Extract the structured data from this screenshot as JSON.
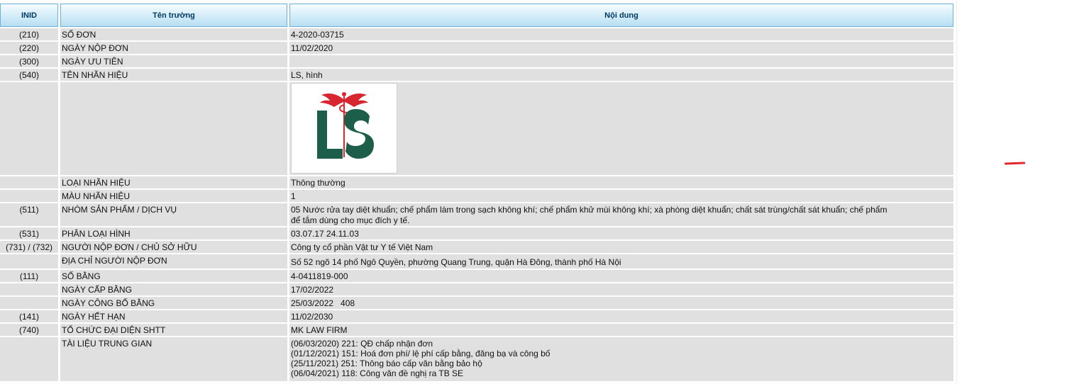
{
  "header": {
    "inid": "INID",
    "field": "Tên trường",
    "content": "Nội dung"
  },
  "rows": {
    "so_don": {
      "inid": "(210)",
      "field": "SỐ ĐƠN",
      "value": "4-2020-03715"
    },
    "ngay_nop_don": {
      "inid": "(220)",
      "field": "NGÀY NỘP ĐƠN",
      "value": "11/02/2020"
    },
    "ngay_uu_tien": {
      "inid": "(300)",
      "field": "NGÀY ƯU TIÊN",
      "value": ""
    },
    "ten_nhan_hieu": {
      "inid": "(540)",
      "field": "TÊN NHÃN HIỆU",
      "value": "LS, hình"
    },
    "mark_image": {
      "inid": "",
      "field": "",
      "logo_text": "LS"
    },
    "loai_nhan_hieu": {
      "inid": "",
      "field": "LOẠI NHÃN HIỆU",
      "value": "Thông thường"
    },
    "mau_nhan_hieu": {
      "inid": "",
      "field": "MÀU NHÃN HIỆU",
      "value": "1"
    },
    "nhom_san_pham": {
      "inid": "(511)",
      "field": "NHÓM SẢN PHẨM / DỊCH VỤ",
      "line1": "05 Nước rửa tay diệt khuẩn; chế phẩm làm trong sạch không khí; chế phẩm khử mùi không khí; xà phòng diệt khuẩn; chất sát trùng/chất sát khuẩn; chế phẩm",
      "line2": "để tắm dùng cho mục đích y tế."
    },
    "phan_loai_hinh": {
      "inid": "(531)",
      "field": "PHÂN LOẠI HÌNH",
      "value": "03.07.17 24.11.03"
    },
    "nguoi_nop_don": {
      "inid": "(731) / (732)",
      "field": "NGƯỜI NỘP ĐƠN / CHỦ SỞ HỮU",
      "value": "Công ty cổ phần Vật tư Y tế Việt Nam"
    },
    "dia_chi": {
      "inid": "",
      "field": "ĐỊA CHỈ NGƯỜI NỘP ĐƠN",
      "value": "Số 52 ngõ 14 phố Ngô Quyền, phường Quang Trung, quận Hà Đông, thành phố Hà Nội"
    },
    "so_bang": {
      "inid": "(111)",
      "field": "SỐ BẰNG",
      "value": "4-0411819-000"
    },
    "ngay_cap_bang": {
      "inid": "",
      "field": "NGÀY CẤP BẰNG",
      "value": "17/02/2022"
    },
    "ngay_cong_bo_bang": {
      "inid": "",
      "field": "NGÀY CÔNG BỐ BẰNG",
      "value": "25/03/2022   408"
    },
    "ngay_het_han": {
      "inid": "(141)",
      "field": "NGÀY HẾT HẠN",
      "value": "11/02/2030"
    },
    "to_chuc_dai_dien": {
      "inid": "(740)",
      "field": "TỔ CHỨC ĐẠI DIỆN SHTT",
      "value": "MK LAW FIRM"
    },
    "tai_lieu": {
      "inid": "",
      "field": "TÀI LIỆU TRUNG GIAN",
      "items": [
        "(06/03/2020) 221: QĐ chấp nhận đơn",
        "(01/12/2021) 151: Hoá đơn phí/ lệ phí cấp bằng, đăng bạ và công bố",
        "(25/11/2021) 251: Thông báo cấp văn bằng bảo hộ",
        "(06/04/2021) 118: Công văn đề nghị ra TB SE"
      ]
    }
  },
  "colors": {
    "header_bg": "#cfeaf8",
    "header_border": "#6ab0d9",
    "row_bg": "#e0e0e0",
    "logo_green": "#1d5e4b",
    "logo_red": "#d7262f",
    "annotation_red": "#e0282e"
  }
}
